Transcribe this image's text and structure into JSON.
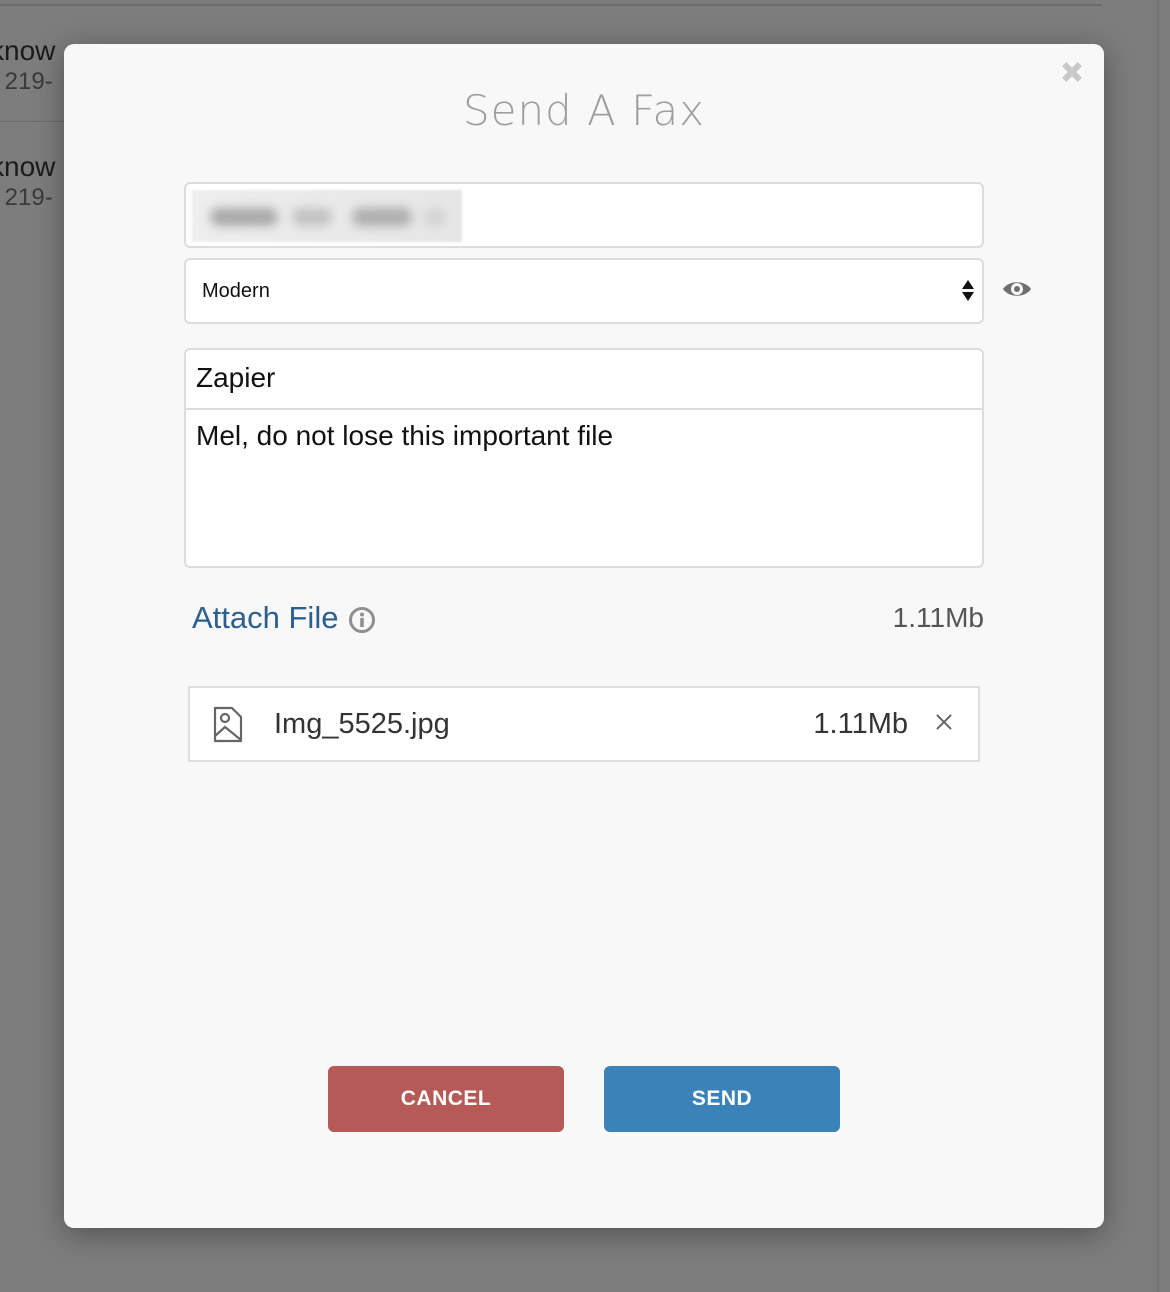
{
  "background": {
    "items": [
      {
        "name_fragment": "know",
        "number_fragment": ") 219-"
      },
      {
        "name_fragment": "know",
        "number_fragment": ") 219-"
      }
    ]
  },
  "modal": {
    "title": "Send A Fax",
    "close_icon": "close-x-icon",
    "recipient": {
      "value": "(blurred phone number)",
      "blurred": true
    },
    "template_select": {
      "selected": "Modern",
      "preview_icon": "eye-icon"
    },
    "cover": {
      "subject": "Zapier",
      "message": "Mel, do not lose this important file"
    },
    "attach": {
      "label": "Attach File",
      "info_icon": "info-circle-icon",
      "total_size": "1.11Mb"
    },
    "files": [
      {
        "icon": "image-file-icon",
        "name": "Img_5525.jpg",
        "size": "1.11Mb",
        "remove_icon": "close-icon"
      }
    ],
    "buttons": {
      "cancel": "CANCEL",
      "send": "SEND"
    },
    "colors": {
      "cancel": "#b55a56",
      "send": "#3b82b9",
      "link": "#2c5f8f"
    }
  }
}
